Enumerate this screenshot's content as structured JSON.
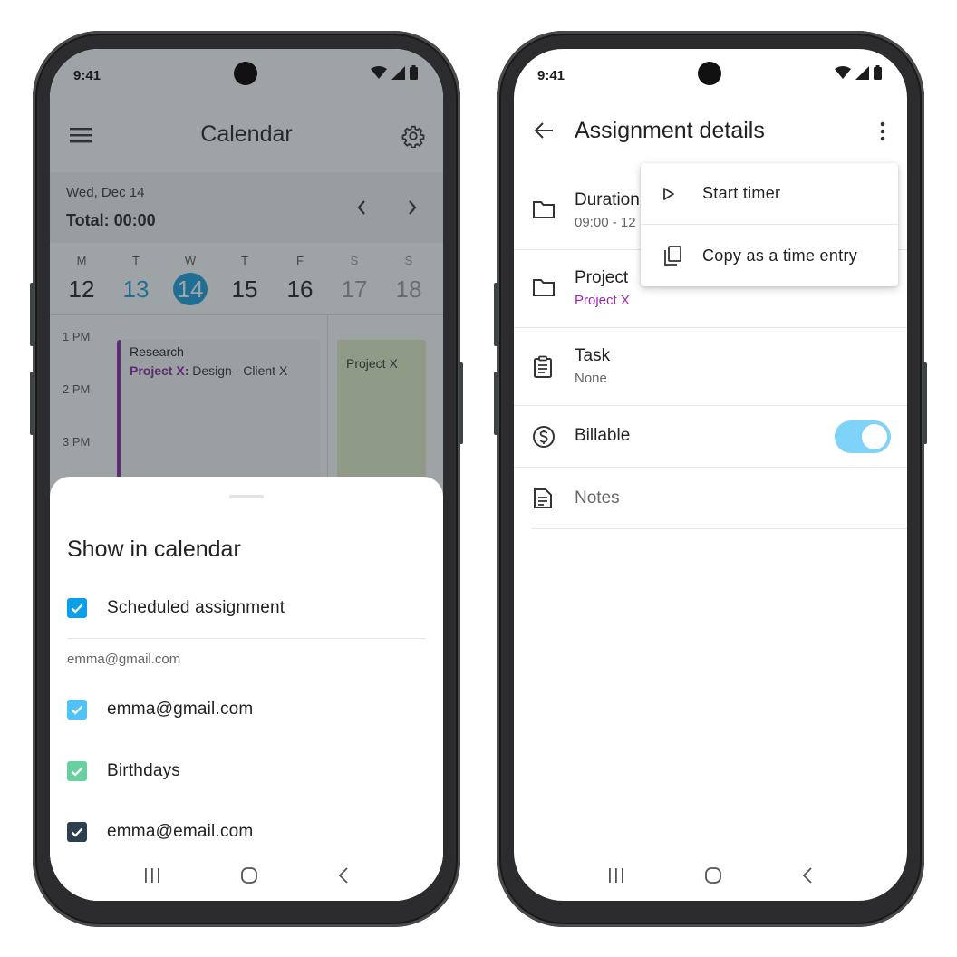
{
  "left_phone": {
    "status_time": "9:41",
    "header": {
      "title": "Calendar"
    },
    "date_bar": {
      "date": "Wed, Dec 14",
      "total": "Total: 00:00"
    },
    "week": [
      {
        "letter": "M",
        "num": "12"
      },
      {
        "letter": "T",
        "num": "13"
      },
      {
        "letter": "W",
        "num": "14"
      },
      {
        "letter": "T",
        "num": "15"
      },
      {
        "letter": "F",
        "num": "16"
      },
      {
        "letter": "S",
        "num": "17"
      },
      {
        "letter": "S",
        "num": "18"
      }
    ],
    "hours": [
      "1 PM",
      "2 PM",
      "3 PM"
    ],
    "event1": {
      "title": "Research",
      "project": "Project X:",
      "detail": " Design - Client X",
      "color": "#8e24aa"
    },
    "event2": {
      "title": "Project X"
    },
    "sheet": {
      "title": "Show in calendar",
      "scheduled": "Scheduled assignment",
      "account_header": "emma@gmail.com",
      "calendars": [
        {
          "label": "emma@gmail.com",
          "color": "#4fc3f7"
        },
        {
          "label": "Birthdays",
          "color": "#66d19e"
        },
        {
          "label": "emma@email.com",
          "color": "#2c3e50"
        }
      ],
      "scheduled_color": "#0a9fe8"
    }
  },
  "right_phone": {
    "status_time": "9:41",
    "appbar": {
      "title": "Assignment details"
    },
    "rows": {
      "duration": {
        "label": "Duration",
        "value": "09:00 - 12"
      },
      "project": {
        "label": "Project",
        "value": "Project X"
      },
      "task": {
        "label": "Task",
        "value": "None"
      },
      "billable": {
        "label": "Billable",
        "on": true
      },
      "notes": {
        "placeholder": "Notes"
      }
    },
    "menu": {
      "start_timer": "Start timer",
      "copy_entry": "Copy as a time entry"
    }
  },
  "colors": {
    "accent": "#1a9ee0",
    "purple": "#9c27b0",
    "toggle": "#7fd2f8"
  }
}
